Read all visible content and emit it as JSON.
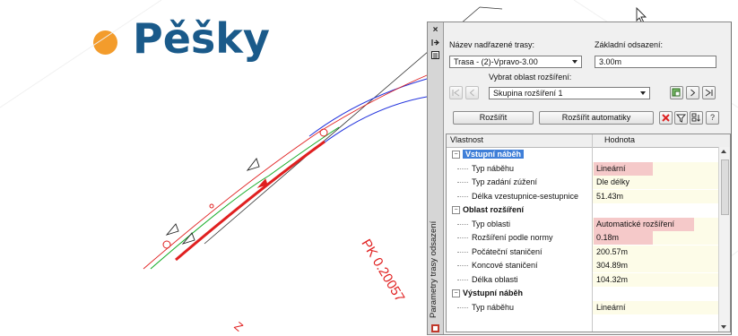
{
  "slide": {
    "title": "Pěšky",
    "title_color": "#1a5a8a",
    "dot_color": "#f39c2c"
  },
  "drawing": {
    "station_label_1": "PK 0.20057",
    "station_label_2": "Z"
  },
  "palette": {
    "vertical_title": "Parametry trasy odsazení",
    "parent_alignment_label": "Název nadřazené trasy:",
    "parent_alignment_value": "Trasa - (2)-Vpravo-3.00",
    "base_offset_label": "Základní odsazení:",
    "base_offset_value": "3.00m",
    "widening_region_label": "Vybrat oblast rozšíření:",
    "widening_region_value": "Skupina rozšíření 1",
    "widen_button": "Rozšířit",
    "widen_auto_button": "Rozšířit automatiky",
    "help_button": "?",
    "close_icon": "×"
  },
  "grid": {
    "col_property": "Vlastnost",
    "col_value": "Hodnota",
    "rows": [
      {
        "type": "category",
        "name": "Vstupní náběh",
        "value": ""
      },
      {
        "type": "item",
        "name": "Typ náběhu",
        "value": "Lineární"
      },
      {
        "type": "item",
        "name": "Typ zadání zúžení",
        "value": "Dle délky"
      },
      {
        "type": "item",
        "name": "Délka vzestupnice-sestupnice",
        "value": "51.43m"
      },
      {
        "type": "category",
        "name": "Oblast rozšíření",
        "value": ""
      },
      {
        "type": "item",
        "name": "Typ oblasti",
        "value": "Automatické rozšíření"
      },
      {
        "type": "item",
        "name": "Rozšíření podle normy",
        "value": "0.18m"
      },
      {
        "type": "item",
        "name": "Počáteční staničení",
        "value": "200.57m"
      },
      {
        "type": "item",
        "name": "Koncové staničení",
        "value": "304.89m"
      },
      {
        "type": "item",
        "name": "Délka oblasti",
        "value": "104.32m"
      },
      {
        "type": "category",
        "name": "Výstupní náběh",
        "value": ""
      },
      {
        "type": "item",
        "name": "Typ náběhu",
        "value": "Lineární"
      }
    ]
  },
  "colors": {
    "selection_blue": "#3f7fd8",
    "highlight_red": "#f5c9c9",
    "value_column_bg": "#fdfce8",
    "line_blue": "#2233dd",
    "line_green": "#11aa22",
    "line_red": "#e02020"
  }
}
